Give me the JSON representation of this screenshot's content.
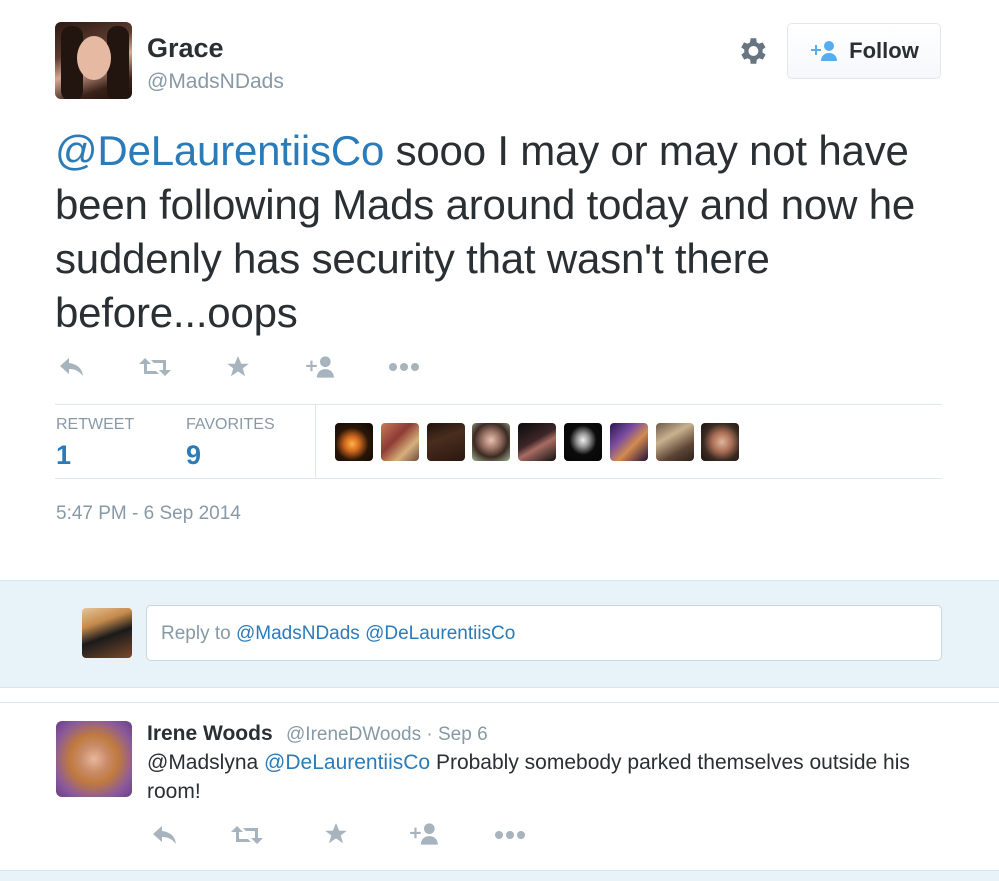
{
  "author": {
    "name": "Grace",
    "handle": "@MadsNDads"
  },
  "follow_button": {
    "label": "Follow"
  },
  "tweet": {
    "mention": "@DeLaurentiisCo",
    "text": " sooo I may or may not have been following Mads around today and now he suddenly has security that wasn't there before...oops"
  },
  "actions": [
    "reply-icon",
    "retweet-icon",
    "favorite-icon",
    "follow-icon",
    "more-icon"
  ],
  "stats": {
    "retweet_label": "RETWEET",
    "retweet_count": "1",
    "favorites_label": "FAVORITES",
    "favorites_count": "9"
  },
  "timestamp": "5:47 PM - 6 Sep 2014",
  "reply_box": {
    "prefix": "Reply to ",
    "mention1": "@MadsNDads",
    "space": " ",
    "mention2": "@DeLaurentiisCo"
  },
  "reply_tweet": {
    "name": "Irene Woods",
    "handle_time": "@IreneDWoods · Sep 6",
    "mention1": "@Madslyna",
    "space": " ",
    "mention2": "@DeLaurentiisCo",
    "text": " Probably somebody parked themselves outside his room!"
  },
  "colors": {
    "link": "#2b7bb9",
    "muted": "#8899a6",
    "text": "#292f33",
    "reply_band": "#e8f3f9"
  }
}
